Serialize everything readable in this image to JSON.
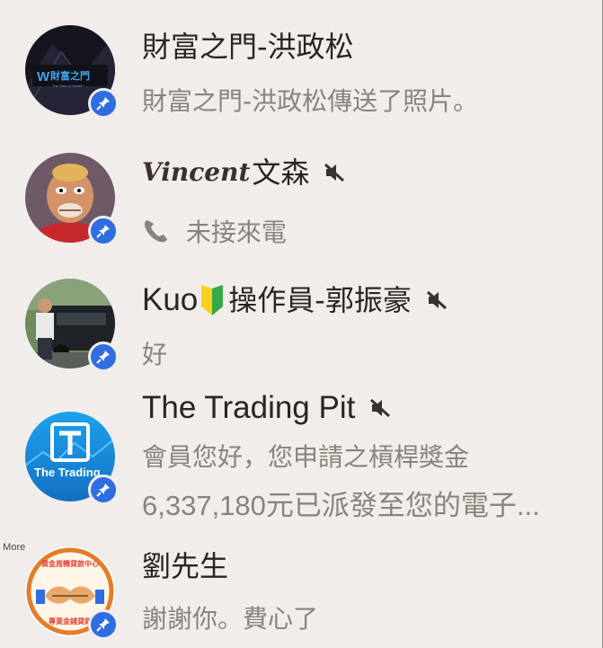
{
  "colors": {
    "background": "#f0edea",
    "name_text": "#2b2422",
    "preview_text": "#8a837d",
    "pin_badge": "#2f6de1"
  },
  "side_label": "n More",
  "chats": [
    {
      "name": "財富之門-洪政松",
      "preview": "財富之門-洪政松傳送了照片。",
      "avatar_text": "財富之門",
      "muted": false,
      "pinned": true
    },
    {
      "name_script": "Vincent",
      "name": "文森",
      "preview": "未接來電",
      "preview_icon": "phone-icon",
      "muted": true,
      "pinned": true
    },
    {
      "name_prefix": "Kuo",
      "name_emoji": "shield-beginner-icon",
      "name": "操作員-郭振豪",
      "preview": "好",
      "muted": true,
      "pinned": true
    },
    {
      "name": "The Trading Pit",
      "preview_line1": "會員您好，您申請之槓桿獎金",
      "preview_line2": "6,337,180元已派發至您的電子...",
      "avatar_text": "The Trading",
      "muted": true,
      "pinned": true
    },
    {
      "name": "劉先生",
      "preview": "謝謝你。費心了",
      "avatar_text_top": "資金周轉貸款中心",
      "avatar_text_bottom": "專業金錢貸款",
      "muted": false,
      "pinned": true
    }
  ]
}
